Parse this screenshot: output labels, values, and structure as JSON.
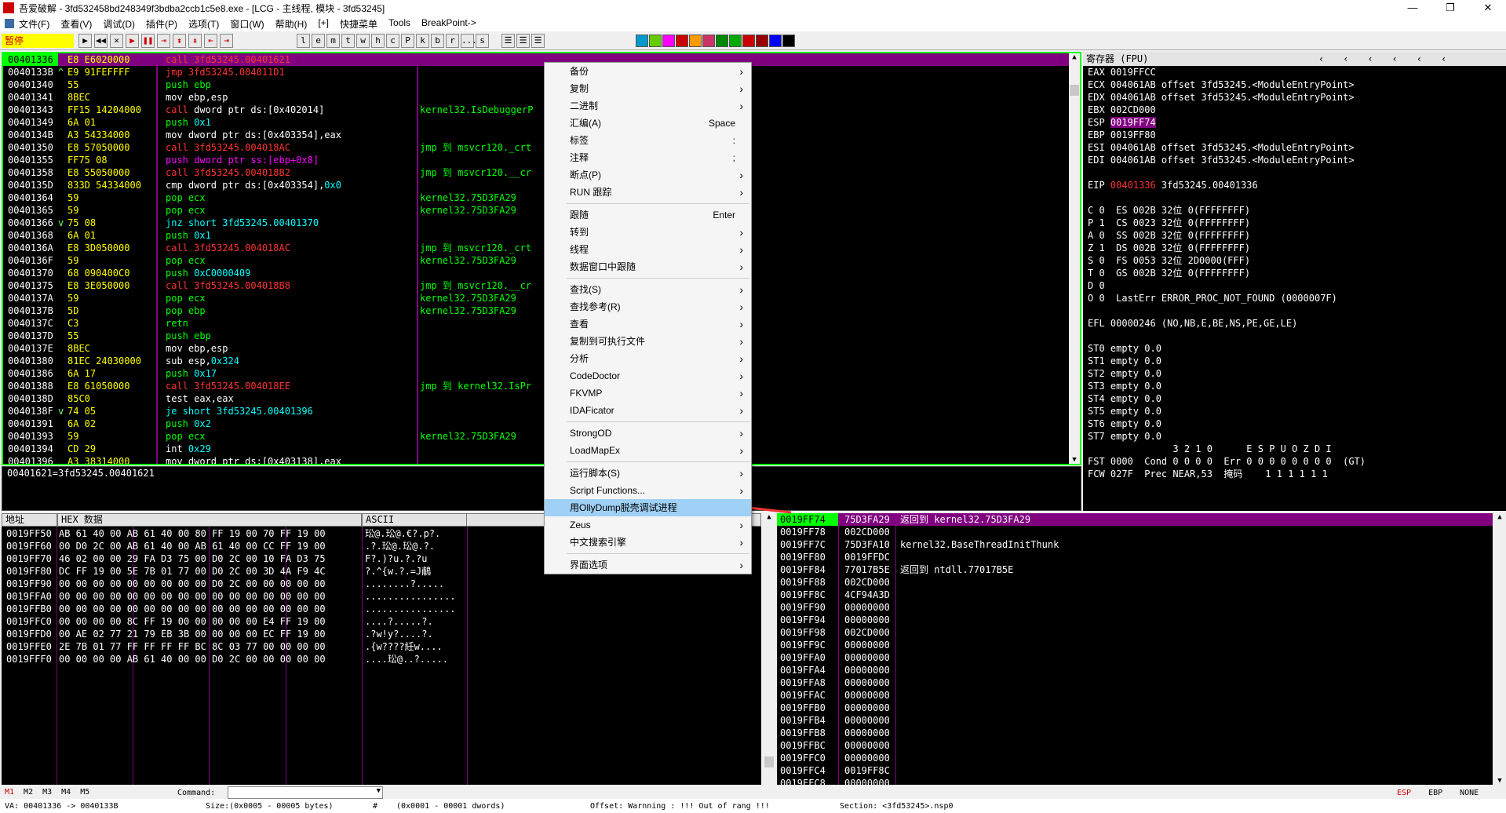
{
  "window": {
    "title": "吾爱破解 - 3fd532458bd248349f3bdba2ccb1c5e8.exe - [LCG - 主线程, 模块 - 3fd53245]",
    "min": "—",
    "max": "❐",
    "close": "✕"
  },
  "menu": [
    "文件(F)",
    "查看(V)",
    "调试(D)",
    "插件(P)",
    "选项(T)",
    "窗口(W)",
    "帮助(H)",
    "[+]",
    "快捷菜单",
    "Tools",
    "BreakPoint->"
  ],
  "toolbar": {
    "state": "暂停",
    "letters": [
      "l",
      "e",
      "m",
      "t",
      "w",
      "h",
      "c",
      "P",
      "k",
      "b",
      "r",
      "...",
      "s"
    ]
  },
  "cpu": {
    "rows": [
      {
        "a": "00401336",
        "m": "",
        "h": "E8 E6020000",
        "d": [
          [
            "call",
            "call 3fd53245.00401621"
          ]
        ],
        "c": "",
        "sel": true
      },
      {
        "a": "0040133B",
        "m": "^",
        "h": "E9 91FEFFFF",
        "d": [
          [
            "call",
            "jmp 3fd53245.004011D1"
          ]
        ],
        "c": ""
      },
      {
        "a": "00401340",
        "m": "",
        "h": "55",
        "d": [
          [
            "push",
            "push ebp"
          ]
        ],
        "c": ""
      },
      {
        "a": "00401341",
        "m": "",
        "h": "8BEC",
        "d": [
          [
            "plain",
            "mov ebp,esp"
          ]
        ],
        "c": ""
      },
      {
        "a": "00401343",
        "m": "",
        "h": "FF15 14204000",
        "d": [
          [
            "call",
            "call "
          ],
          [
            "plain",
            "dword ptr ds:[0x402014]"
          ]
        ],
        "c": "kernel32.IsDebuggerP"
      },
      {
        "a": "00401349",
        "m": "",
        "h": "6A 01",
        "d": [
          [
            "push",
            "push "
          ],
          [
            "num",
            "0x1"
          ]
        ],
        "c": ""
      },
      {
        "a": "0040134B",
        "m": "",
        "h": "A3 54334000",
        "d": [
          [
            "plain",
            "mov dword ptr ds:[0x403354],eax"
          ]
        ],
        "c": ""
      },
      {
        "a": "00401350",
        "m": "",
        "h": "E8 57050000",
        "d": [
          [
            "call",
            "call 3fd53245.004018AC"
          ]
        ],
        "c": "jmp 到 msvcr120._crt"
      },
      {
        "a": "00401355",
        "m": "",
        "h": "FF75 08",
        "d": [
          [
            "jmp",
            "push dword ptr ss:[ebp+0x8]"
          ]
        ],
        "c": ""
      },
      {
        "a": "00401358",
        "m": "",
        "h": "E8 55050000",
        "d": [
          [
            "call",
            "call 3fd53245.004018B2"
          ]
        ],
        "c": "jmp 到 msvcr120.__cr"
      },
      {
        "a": "0040135D",
        "m": "",
        "h": "833D 54334000",
        "d": [
          [
            "plain",
            "cmp dword ptr ds:[0x403354],"
          ],
          [
            "num",
            "0x0"
          ]
        ],
        "c": ""
      },
      {
        "a": "00401364",
        "m": "",
        "h": "59",
        "d": [
          [
            "push",
            "pop ecx"
          ]
        ],
        "c": "kernel32.75D3FA29"
      },
      {
        "a": "00401365",
        "m": "",
        "h": "59",
        "d": [
          [
            "push",
            "pop ecx"
          ]
        ],
        "c": "kernel32.75D3FA29"
      },
      {
        "a": "00401366",
        "m": "v",
        "h": "75 08",
        "d": [
          [
            "num",
            "jnz short 3fd53245.00401370"
          ]
        ],
        "c": ""
      },
      {
        "a": "00401368",
        "m": "",
        "h": "6A 01",
        "d": [
          [
            "push",
            "push "
          ],
          [
            "num",
            "0x1"
          ]
        ],
        "c": ""
      },
      {
        "a": "0040136A",
        "m": "",
        "h": "E8 3D050000",
        "d": [
          [
            "call",
            "call 3fd53245.004018AC"
          ]
        ],
        "c": "jmp 到 msvcr120._crt"
      },
      {
        "a": "0040136F",
        "m": "",
        "h": "59",
        "d": [
          [
            "push",
            "pop ecx"
          ]
        ],
        "c": "kernel32.75D3FA29"
      },
      {
        "a": "00401370",
        "m": "",
        "h": "68 090400C0",
        "d": [
          [
            "push",
            "push "
          ],
          [
            "num",
            "0xC0000409"
          ]
        ],
        "c": ""
      },
      {
        "a": "00401375",
        "m": "",
        "h": "E8 3E050000",
        "d": [
          [
            "call",
            "call 3fd53245.004018B8"
          ]
        ],
        "c": "jmp 到 msvcr120.__cr"
      },
      {
        "a": "0040137A",
        "m": "",
        "h": "59",
        "d": [
          [
            "push",
            "pop ecx"
          ]
        ],
        "c": "kernel32.75D3FA29"
      },
      {
        "a": "0040137B",
        "m": "",
        "h": "5D",
        "d": [
          [
            "push",
            "pop ebp"
          ]
        ],
        "c": "kernel32.75D3FA29"
      },
      {
        "a": "0040137C",
        "m": "",
        "h": "C3",
        "d": [
          [
            "push",
            "retn"
          ]
        ],
        "c": ""
      },
      {
        "a": "0040137D",
        "m": "",
        "h": "55",
        "d": [
          [
            "push",
            "push ebp"
          ]
        ],
        "c": ""
      },
      {
        "a": "0040137E",
        "m": "",
        "h": "8BEC",
        "d": [
          [
            "plain",
            "mov ebp,esp"
          ]
        ],
        "c": ""
      },
      {
        "a": "00401380",
        "m": "",
        "h": "81EC 24030000",
        "d": [
          [
            "plain",
            "sub esp,"
          ],
          [
            "num",
            "0x324"
          ]
        ],
        "c": ""
      },
      {
        "a": "00401386",
        "m": "",
        "h": "6A 17",
        "d": [
          [
            "push",
            "push "
          ],
          [
            "num",
            "0x17"
          ]
        ],
        "c": ""
      },
      {
        "a": "00401388",
        "m": "",
        "h": "E8 61050000",
        "d": [
          [
            "call",
            "call 3fd53245.004018EE"
          ]
        ],
        "c": "jmp 到 kernel32.IsPr"
      },
      {
        "a": "0040138D",
        "m": "",
        "h": "85C0",
        "d": [
          [
            "plain",
            "test eax,eax"
          ]
        ],
        "c": ""
      },
      {
        "a": "0040138F",
        "m": "v",
        "h": "74 05",
        "d": [
          [
            "num",
            "je short 3fd53245.00401396"
          ]
        ],
        "c": ""
      },
      {
        "a": "00401391",
        "m": "",
        "h": "6A 02",
        "d": [
          [
            "push",
            "push "
          ],
          [
            "num",
            "0x2"
          ]
        ],
        "c": ""
      },
      {
        "a": "00401393",
        "m": "",
        "h": "59",
        "d": [
          [
            "push",
            "pop ecx"
          ]
        ],
        "c": "kernel32.75D3FA29"
      },
      {
        "a": "00401394",
        "m": "",
        "h": "CD 29",
        "d": [
          [
            "plain",
            "int "
          ],
          [
            "num",
            "0x29"
          ]
        ],
        "c": ""
      },
      {
        "a": "00401396",
        "m": "",
        "h": "A3 38314000",
        "d": [
          [
            "plain",
            "mov dword ptr ds:[0x403138],eax"
          ]
        ],
        "c": ""
      }
    ],
    "info": "00401621=3fd53245.00401621"
  },
  "registers": {
    "header": "寄存器 (FPU)",
    "lines": [
      "EAX 0019FFCC",
      "ECX 004061AB offset 3fd53245.<ModuleEntryPoint>",
      "EDX 004061AB offset 3fd53245.<ModuleEntryPoint>",
      "EBX 002CD000",
      "ESP 0019FF74",
      "EBP 0019FF80",
      "ESI 004061AB offset 3fd53245.<ModuleEntryPoint>",
      "EDI 004061AB offset 3fd53245.<ModuleEntryPoint>",
      "",
      "EIP 00401336 3fd53245.00401336",
      "",
      "C 0  ES 002B 32位 0(FFFFFFFF)",
      "P 1  CS 0023 32位 0(FFFFFFFF)",
      "A 0  SS 002B 32位 0(FFFFFFFF)",
      "Z 1  DS 002B 32位 0(FFFFFFFF)",
      "S 0  FS 0053 32位 2D0000(FFF)",
      "T 0  GS 002B 32位 0(FFFFFFFF)",
      "D 0",
      "O 0  LastErr ERROR_PROC_NOT_FOUND (0000007F)",
      "",
      "EFL 00000246 (NO,NB,E,BE,NS,PE,GE,LE)",
      "",
      "ST0 empty 0.0",
      "ST1 empty 0.0",
      "ST2 empty 0.0",
      "ST3 empty 0.0",
      "ST4 empty 0.0",
      "ST5 empty 0.0",
      "ST6 empty 0.0",
      "ST7 empty 0.0",
      "               3 2 1 0      E S P U O Z D I",
      "FST 0000  Cond 0 0 0 0  Err 0 0 0 0 0 0 0 0  (GT)",
      "FCW 027F  Prec NEAR,53  掩码    1 1 1 1 1 1"
    ]
  },
  "context_menu": [
    {
      "t": "备份",
      "ar": true
    },
    {
      "t": "复制",
      "ar": true
    },
    {
      "t": "二进制",
      "ar": true
    },
    {
      "t": "汇编(A)",
      "sc": "Space"
    },
    {
      "t": "标签",
      "sc": ":"
    },
    {
      "t": "注释",
      "sc": ";"
    },
    {
      "t": "断点(P)",
      "ar": true
    },
    {
      "t": "RUN 跟踪",
      "ar": true
    },
    {
      "sep": true
    },
    {
      "t": "跟随",
      "sc": "Enter"
    },
    {
      "t": "转到",
      "ar": true
    },
    {
      "t": "线程",
      "ar": true
    },
    {
      "t": "数据窗口中跟随",
      "ar": true
    },
    {
      "sep": true
    },
    {
      "t": "查找(S)",
      "ar": true
    },
    {
      "t": "查找参考(R)",
      "ar": true
    },
    {
      "t": "查看",
      "ar": true
    },
    {
      "t": "复制到可执行文件",
      "ar": true
    },
    {
      "t": "分析",
      "ar": true
    },
    {
      "t": "CodeDoctor",
      "ar": true
    },
    {
      "t": "FKVMP",
      "ar": true
    },
    {
      "t": "IDAFicator",
      "ar": true
    },
    {
      "sep": true
    },
    {
      "t": "StrongOD",
      "ar": true
    },
    {
      "t": "LoadMapEx",
      "ar": true
    },
    {
      "sep": true
    },
    {
      "t": "运行脚本(S)",
      "ar": true
    },
    {
      "t": "Script Functions...",
      "ar": true
    },
    {
      "t": "用OllyDump脱壳调试进程",
      "ar": false,
      "hl": true
    },
    {
      "t": "Zeus",
      "ar": true
    },
    {
      "t": "中文搜索引擎",
      "ar": true
    },
    {
      "sep": true
    },
    {
      "t": "界面选项",
      "ar": true
    }
  ],
  "dump": {
    "h_addr": "地址",
    "h_hex": "HEX 数据",
    "h_ascii": "ASCII",
    "rows": [
      [
        "0019FF50",
        "AB 61 40 00 AB 61 40 00 80 FF 19 00 70 FF 19 00",
        "玜@.玜@.€?.p?."
      ],
      [
        "0019FF60",
        "00 D0 2C 00 AB 61 40 00 AB 61 40 00 CC FF 19 00",
        ".?.玜@.玜@.?."
      ],
      [
        "0019FF70",
        "46 02 00 00 29 FA D3 75 00 D0 2C 00 10 FA D3 75",
        "F?.)?u.?.?u"
      ],
      [
        "0019FF80",
        "DC FF 19 00 5E 7B 01 77 00 D0 2C 00 3D 4A F9 4C",
        "?.^{w.?.=J鵏"
      ],
      [
        "0019FF90",
        "00 00 00 00 00 00 00 00 00 D0 2C 00 00 00 00 00",
        "........?....."
      ],
      [
        "0019FFA0",
        "00 00 00 00 00 00 00 00 00 00 00 00 00 00 00 00",
        "................"
      ],
      [
        "0019FFB0",
        "00 00 00 00 00 00 00 00 00 00 00 00 00 00 00 00",
        "................"
      ],
      [
        "0019FFC0",
        "00 00 00 00 8C FF 19 00 00 00 00 00 E4 FF 19 00",
        "....?.....?."
      ],
      [
        "0019FFD0",
        "00 AE 02 77 21 79 EB 3B 00 00 00 00 EC FF 19 00",
        ".?w!y?....?."
      ],
      [
        "0019FFE0",
        "2E 7B 01 77 FF FF FF FF BC 8C 03 77 00 00 00 00",
        ".{w????紝w...."
      ],
      [
        "0019FFF0",
        "00 00 00 00 AB 61 40 00 00 D0 2C 00 00 00 00 00",
        "....玜@..?....."
      ]
    ]
  },
  "stack": {
    "rows": [
      [
        "0019FF74",
        "75D3FA29",
        "返回到 kernel32.75D3FA29"
      ],
      [
        "0019FF78",
        "002CD000",
        ""
      ],
      [
        "0019FF7C",
        "75D3FA10",
        "kernel32.BaseThreadInitThunk"
      ],
      [
        "0019FF80",
        "0019FFDC",
        ""
      ],
      [
        "0019FF84",
        "77017B5E",
        "返回到 ntdll.77017B5E"
      ],
      [
        "0019FF88",
        "002CD000",
        ""
      ],
      [
        "0019FF8C",
        "4CF94A3D",
        ""
      ],
      [
        "0019FF90",
        "00000000",
        ""
      ],
      [
        "0019FF94",
        "00000000",
        ""
      ],
      [
        "0019FF98",
        "002CD000",
        ""
      ],
      [
        "0019FF9C",
        "00000000",
        ""
      ],
      [
        "0019FFA0",
        "00000000",
        ""
      ],
      [
        "0019FFA4",
        "00000000",
        ""
      ],
      [
        "0019FFA8",
        "00000000",
        ""
      ],
      [
        "0019FFAC",
        "00000000",
        ""
      ],
      [
        "0019FFB0",
        "00000000",
        ""
      ],
      [
        "0019FFB4",
        "00000000",
        ""
      ],
      [
        "0019FFB8",
        "00000000",
        ""
      ],
      [
        "0019FFBC",
        "00000000",
        ""
      ],
      [
        "0019FFC0",
        "00000000",
        ""
      ],
      [
        "0019FFC4",
        "0019FF8C",
        ""
      ],
      [
        "0019FFC8",
        "00000000",
        ""
      ]
    ]
  },
  "bottom": {
    "tabs": [
      "M1",
      "M2",
      "M3",
      "M4",
      "M5"
    ],
    "command_label": "Command:",
    "reg_buttons": [
      "ESP",
      "EBP",
      "NONE"
    ]
  },
  "status": {
    "va": "VA: 00401336 -> 0040133B",
    "size": "Size:(0x0005 - 00005 bytes)",
    "hash": "#",
    "dwords": "(0x0001 - 00001 dwords)",
    "offset": "Offset: Warnning : !!! Out of rang !!!",
    "section": "Section: <3fd53245>.nsp0"
  },
  "colors": {
    "accent": "#800080",
    "highlight": "#00ff00"
  }
}
